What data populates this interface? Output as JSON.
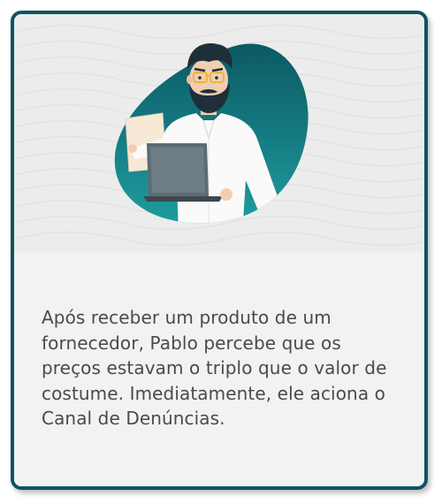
{
  "card": {
    "accent_color": "#0c5560",
    "background_color": "#f2f2f2"
  },
  "illustration": {
    "icon": "man-with-laptop-and-document-illustration",
    "blob_color_start": "#0f5f6b",
    "blob_color_end": "#1e9a9d"
  },
  "caption": {
    "text": "Após receber um produto de um fornecedor, Pablo percebe que os preços estavam o triplo que o valor de costume. Imediatamente, ele aciona o Canal de Denúncias."
  }
}
